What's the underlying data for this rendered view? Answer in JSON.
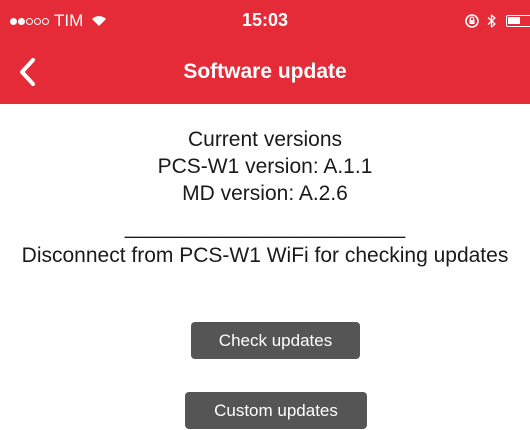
{
  "status_bar": {
    "carrier": "TIM",
    "time": "15:03"
  },
  "nav": {
    "title": "Software update"
  },
  "versions": {
    "heading": "Current versions",
    "pcs_line": "PCS-W1 version: A.1.1",
    "md_line": "MD version: A.2.6"
  },
  "separator": "________________________",
  "info": "Disconnect from PCS-W1 WiFi for checking updates",
  "buttons": {
    "check": "Check updates",
    "custom": "Custom updates"
  },
  "colors": {
    "accent": "#e42b37",
    "button_bg": "#555555",
    "text": "#1a1a1a"
  },
  "icons": {
    "back": "chevron-left-icon",
    "wifi": "wifi-icon",
    "rotation_lock": "rotation-lock-icon",
    "bluetooth": "bluetooth-icon",
    "battery": "battery-icon"
  }
}
